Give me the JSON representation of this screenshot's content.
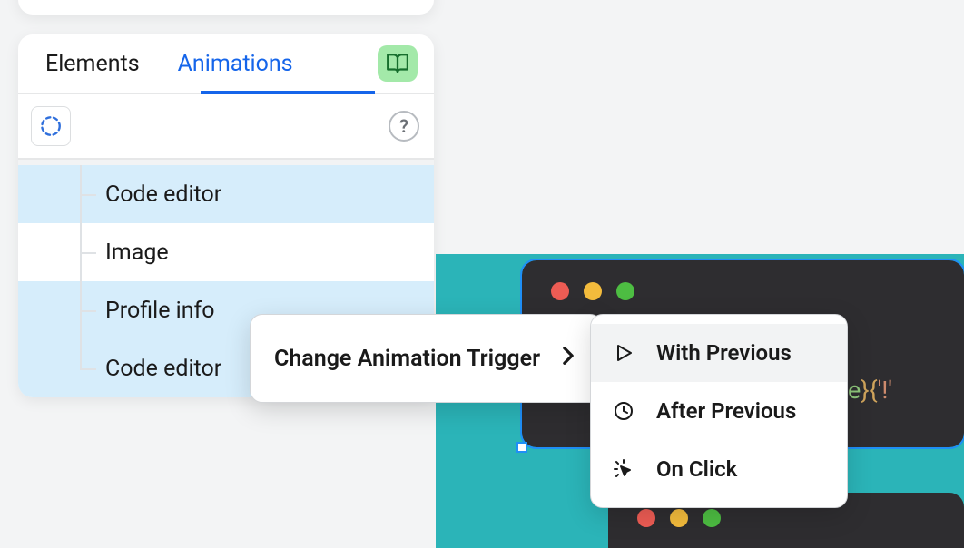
{
  "tabs": {
    "elements": "Elements",
    "animations": "Animations"
  },
  "help": "?",
  "anim_items": [
    {
      "label": "Code editor",
      "selected": true
    },
    {
      "label": "Image",
      "selected": false
    },
    {
      "label": "Profile info",
      "selected": true
    },
    {
      "label": "Code editor",
      "selected": true
    }
  ],
  "context_menu": {
    "change_trigger": "Change Animation Trigger"
  },
  "trigger_options": {
    "with_previous": "With Previous",
    "after_previous": "After Previous",
    "on_click": "On Click"
  },
  "code_snippet": {
    "ident": "e",
    "brace_open": "}{",
    "str": "'!'"
  }
}
